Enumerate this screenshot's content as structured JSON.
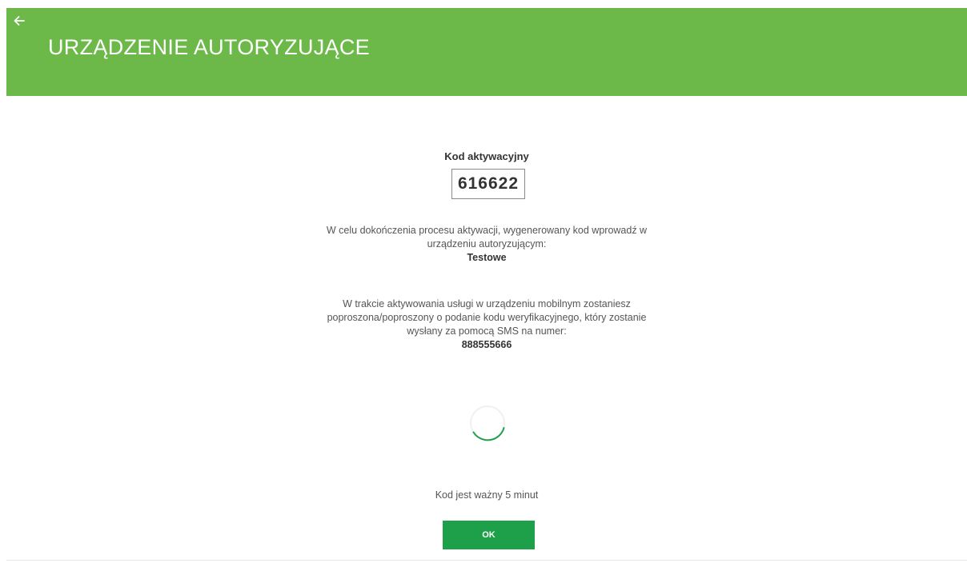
{
  "header": {
    "title": "URZĄDZENIE AUTORYZUJĄCE",
    "back_icon": "arrow-left-icon"
  },
  "activation": {
    "code_label": "Kod aktywacyjny",
    "code": "616622"
  },
  "instructions": {
    "line1": "W celu dokończenia procesu aktywacji, wygenerowany kod wprowadź w",
    "line2": "urządzeniu autoryzującym:",
    "device_name": "Testowe"
  },
  "sms_info": {
    "line1": "W trakcie aktywowania usługi w urządzeniu mobilnym zostaniesz",
    "line2": "poproszona/poproszony o podanie kodu weryfikacyjnego, który zostanie",
    "line3": "wysłany za pomocą SMS na numer:",
    "phone": "888555666"
  },
  "validity_text": "Kod jest ważny 5 minut",
  "ok_label": "OK",
  "colors": {
    "header": "#6cb94a",
    "button": "#1ea04a",
    "spinner": "#1ea04a"
  }
}
